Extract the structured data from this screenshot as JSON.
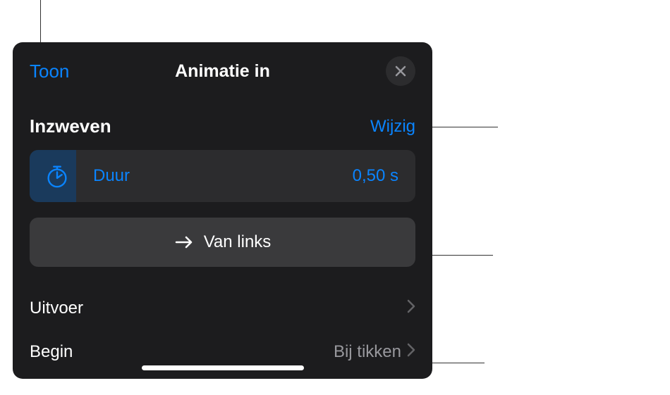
{
  "header": {
    "back_label": "Toon",
    "title": "Animatie in",
    "close_icon": "close-icon"
  },
  "section": {
    "title": "Inzweven",
    "action_label": "Wijzig"
  },
  "duration": {
    "label": "Duur",
    "value": "0,50 s",
    "icon": "timer-icon"
  },
  "direction": {
    "label": "Van links",
    "icon": "arrow-right-icon"
  },
  "rows": {
    "uitvoer": {
      "label": "Uitvoer",
      "value": ""
    },
    "begin": {
      "label": "Begin",
      "value": "Bij tikken"
    }
  },
  "colors": {
    "accent": "#0a84ff",
    "bg_panel": "#1c1c1e",
    "bg_row_dark": "#2c2c2e",
    "bg_row_light": "#3a3a3c"
  }
}
